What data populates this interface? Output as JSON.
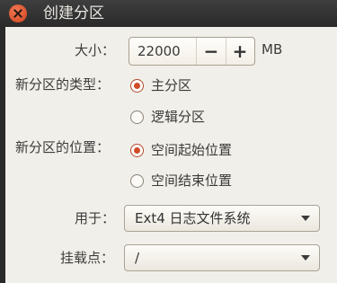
{
  "window": {
    "title": "创建分区"
  },
  "size": {
    "label": "大小：",
    "value": "22000",
    "minus": "−",
    "plus": "+",
    "unit": "MB"
  },
  "type": {
    "label": "新分区的类型：",
    "options": [
      "主分区",
      "逻辑分区"
    ],
    "selected": 0
  },
  "location": {
    "label": "新分区的位置：",
    "options": [
      "空间起始位置",
      "空间结束位置"
    ],
    "selected": 0
  },
  "use_as": {
    "label": "用于：",
    "value": "Ext4 日志文件系统"
  },
  "mount": {
    "label": "挂载点：",
    "value": "/"
  }
}
